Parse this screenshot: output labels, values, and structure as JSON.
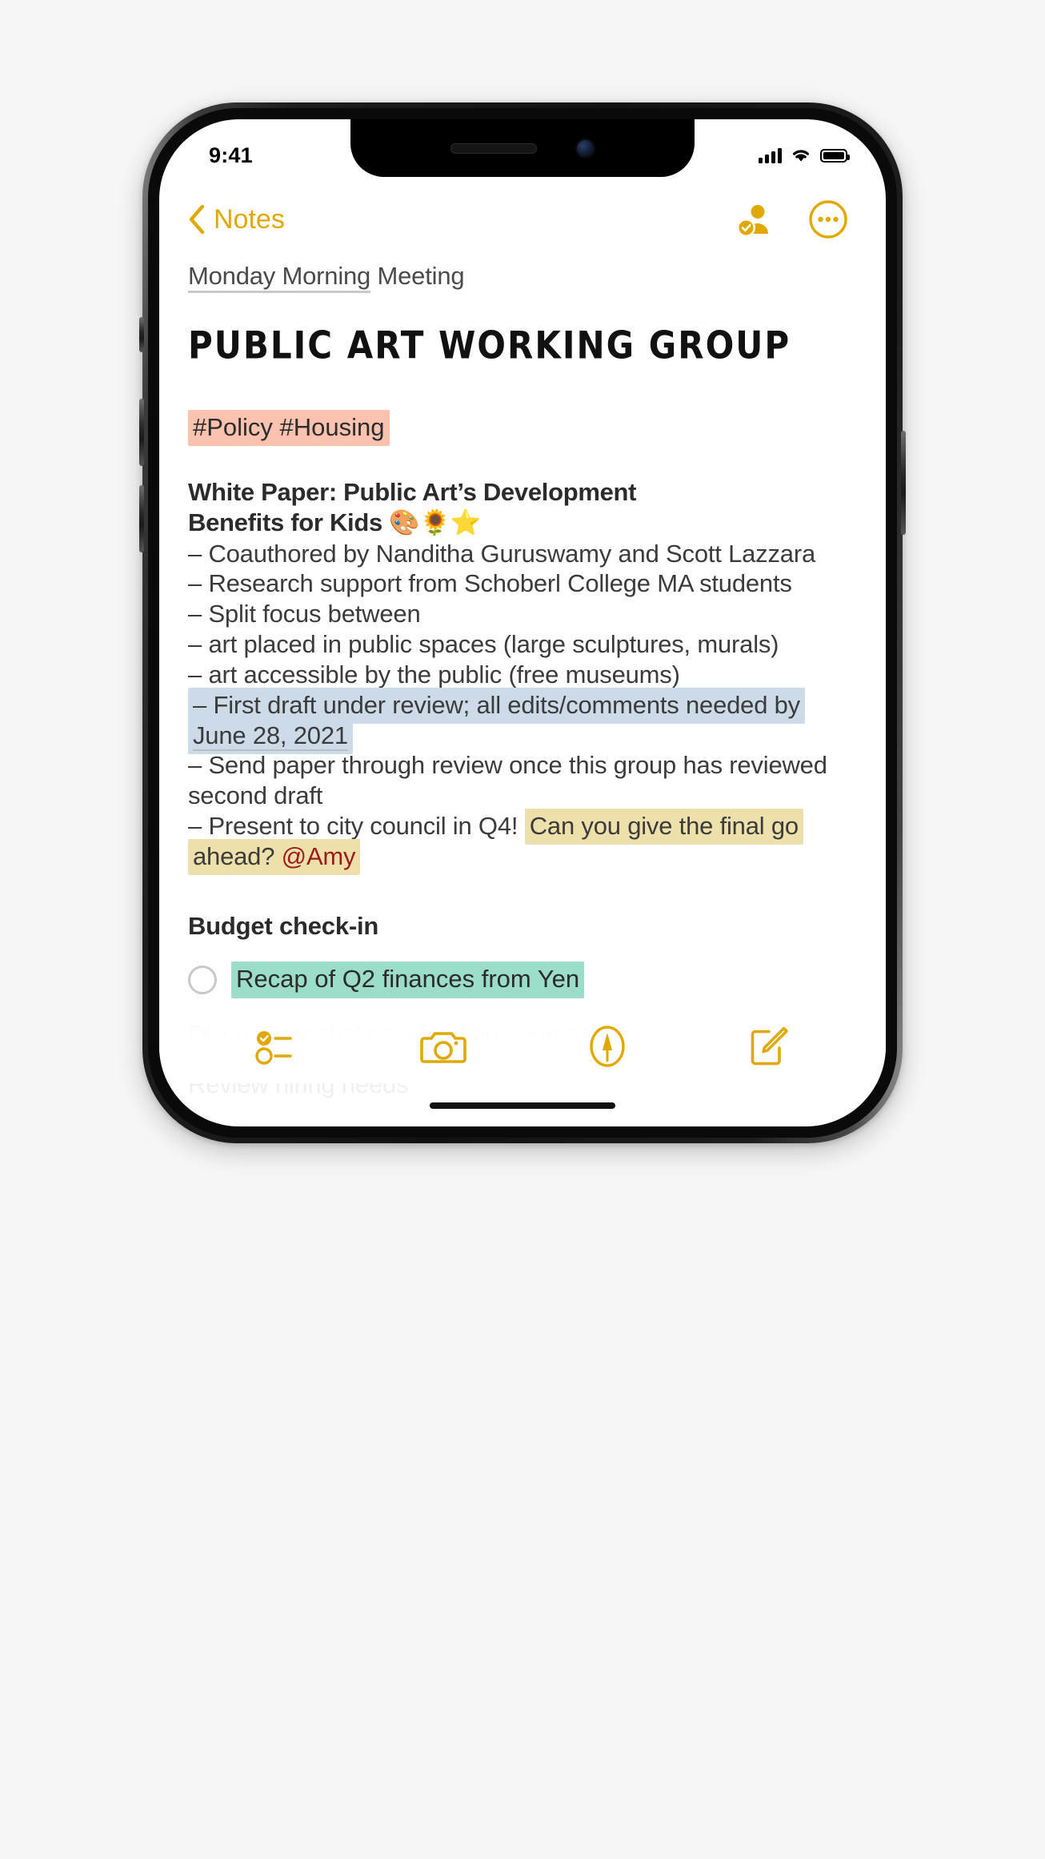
{
  "status_bar": {
    "time": "9:41",
    "signal_icon": "cellular-signal-icon",
    "wifi_icon": "wifi-icon",
    "battery_icon": "battery-full-icon"
  },
  "nav": {
    "back_icon": "chevron-left-icon",
    "back_label": "Notes",
    "collaborate_icon": "person-checkmark-icon",
    "more_icon": "ellipsis-circle-icon"
  },
  "note": {
    "subtitle_underlined": "Monday Morning",
    "subtitle_rest": " Meeting",
    "title": "PUBLIC ART WORKING GROUP",
    "tags": "#Policy #Housing",
    "heading_line1": "White Paper: Public Art’s Development",
    "heading_line2": "Benefits for Kids ",
    "heading_emoji": "🎨🌻⭐",
    "bullets": [
      "– Coauthored by Nanditha Guruswamy and Scott Lazzara",
      "– Research support from Schoberl College MA students",
      "– Split focus between"
    ],
    "sub_bullets": [
      "– art placed in public spaces (large sculptures, murals)",
      "– art accessible by the public (free museums)"
    ],
    "highlight_blue_text_a": "– First draft under review; all edits/comments needed by ",
    "highlight_blue_date": "June 28, 2021",
    "bullet_after_blue": "– Send paper through review once this group has reviewed second draft",
    "bullet_q4_plain": "– Present to city council in Q4! ",
    "bullet_q4_highlight": "Can you give the final go ahead? ",
    "bullet_q4_mention": "@Amy",
    "section_heading": "Budget check-in",
    "checklist_item": "Recap of Q2 finances from Yen",
    "faded_line_1": "Discus potential new funding sources",
    "faded_line_2": "Review hiring needs"
  },
  "toolbar": {
    "checklist_icon": "checklist-icon",
    "camera_icon": "camera-icon",
    "markup_icon": "markup-pen-icon",
    "compose_icon": "compose-icon"
  },
  "colors": {
    "accent": "#e0a800",
    "highlight_pink": "#fbc3af",
    "highlight_blue": "#cddae8",
    "highlight_yellow": "#eee0ab",
    "highlight_green": "#9bddc8",
    "mention_red": "#9e1b1b"
  }
}
